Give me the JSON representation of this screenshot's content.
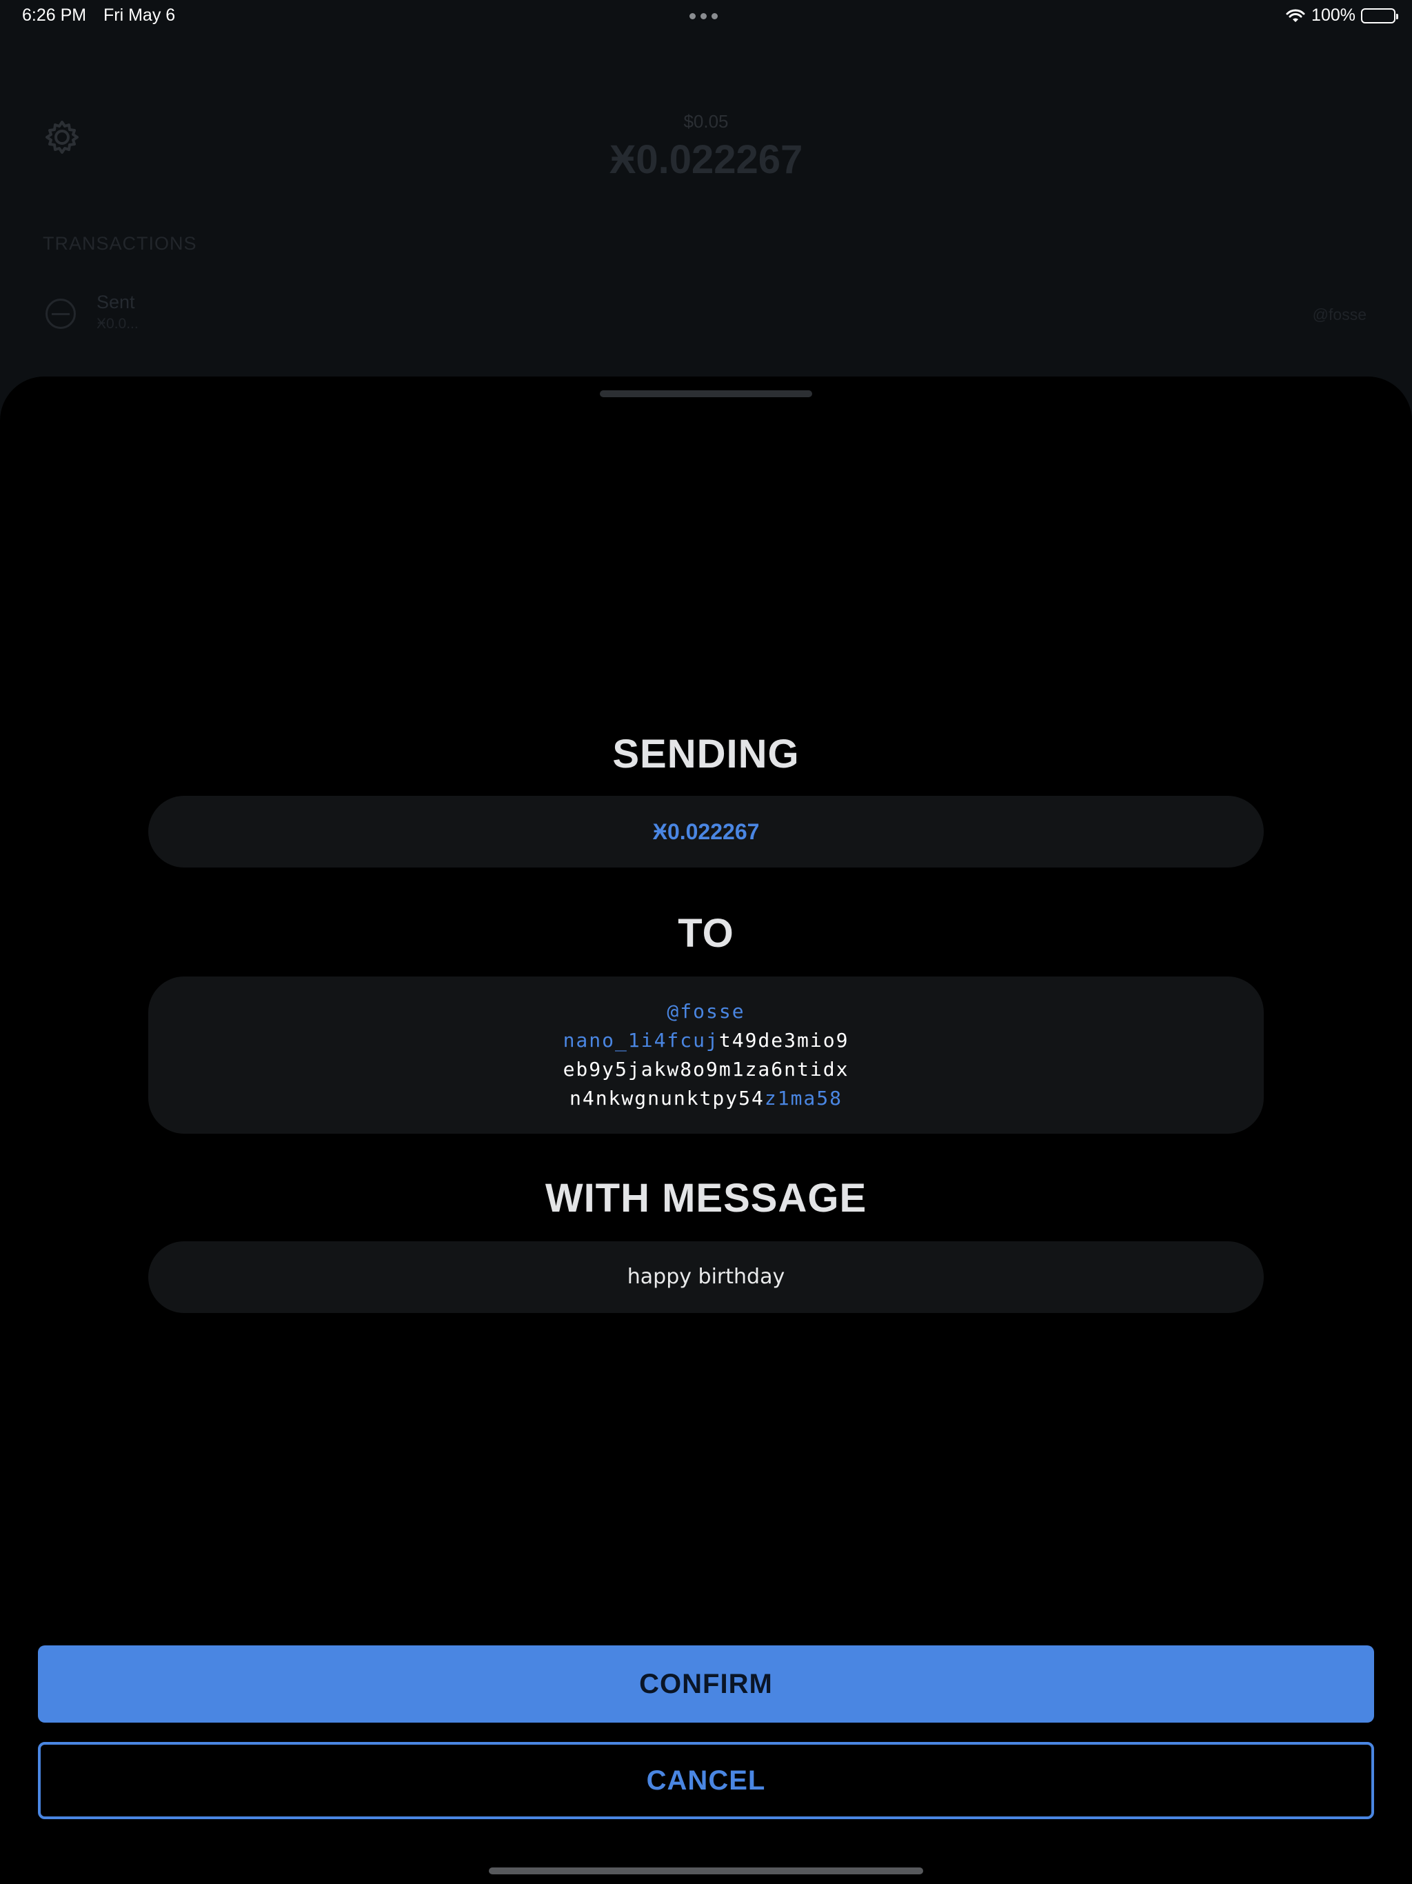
{
  "status_bar": {
    "time": "6:26 PM",
    "date": "Fri May 6",
    "battery": "100%"
  },
  "background": {
    "fiat_balance": "$0.05",
    "balance": "Ӿ0.022267",
    "transactions_header": "TRANSACTIONS",
    "tx_type": "Sent",
    "tx_amount": "Ӿ0.0...",
    "tx_account": "@fosse"
  },
  "sheet": {
    "sending_title": "SENDING",
    "amount": "Ӿ0.022267",
    "to_title": "TO",
    "address": {
      "name": "@fosse",
      "line1_highlight": "nano_1i4fcuj",
      "line1_rest": "t49de3mio9",
      "line2": "eb9y5jakw8o9m1za6ntidx",
      "line3_rest": "n4nkwgnunktpy54",
      "line3_highlight": "z1ma58"
    },
    "message_title": "WITH MESSAGE",
    "message": "happy birthday",
    "confirm_label": "CONFIRM",
    "cancel_label": "CANCEL"
  },
  "colors": {
    "accent": "#4a86e2",
    "background": "#000000",
    "pill": "#121416"
  }
}
